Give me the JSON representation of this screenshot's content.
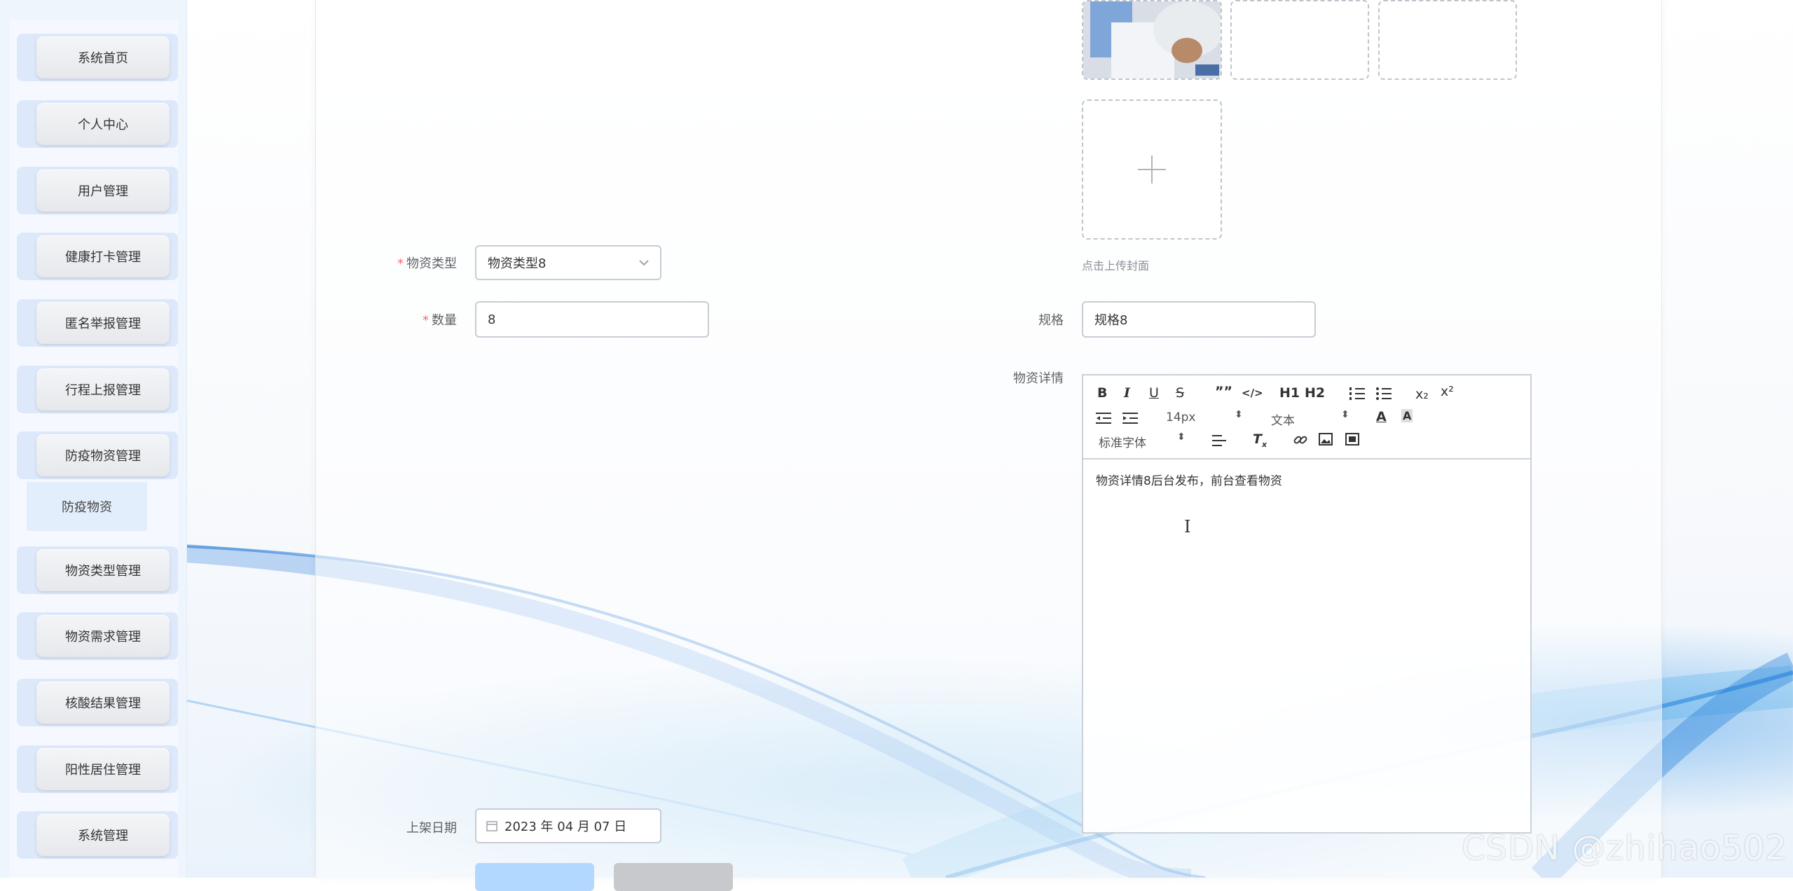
{
  "sidebar": {
    "items": [
      {
        "label": "系统首页"
      },
      {
        "label": "个人中心"
      },
      {
        "label": "用户管理"
      },
      {
        "label": "健康打卡管理"
      },
      {
        "label": "匿名举报管理"
      },
      {
        "label": "行程上报管理"
      },
      {
        "label": "防疫物资管理"
      },
      {
        "label": "物资类型管理"
      },
      {
        "label": "物资需求管理"
      },
      {
        "label": "核酸结果管理"
      },
      {
        "label": "阳性居住管理"
      },
      {
        "label": "系统管理"
      }
    ],
    "submenu": {
      "label": "防疫物资"
    }
  },
  "form": {
    "cover": {
      "hint": "点击上传封面",
      "add_icon": "plus-icon"
    },
    "type": {
      "required_mark": "*",
      "label": "物资类型",
      "value": "物资类型8"
    },
    "quantity": {
      "required_mark": "*",
      "label": "数量",
      "value": "8"
    },
    "spec": {
      "label": "规格",
      "value": "规格8"
    },
    "detail": {
      "label": "物资详情",
      "content": "物资详情8后台发布，前台查看物资",
      "font_size": "14px",
      "block_type": "文本",
      "font_family": "标准字体",
      "toolbar": {
        "bold": "B",
        "italic": "I",
        "underline": "U",
        "strike": "S",
        "blockquote": "””",
        "code": "</>",
        "h1": "H1",
        "h2": "H2",
        "sub": "x₂",
        "sup": "x²"
      }
    },
    "date": {
      "label": "上架日期",
      "value": "2023 年 04 月 07 日"
    }
  },
  "watermark": "CSDN @zhihao502",
  "colors": {
    "accent": "#409eff",
    "required": "#f56c6c",
    "submit": "#b3d8ff",
    "cancel": "#c8c9cc"
  }
}
